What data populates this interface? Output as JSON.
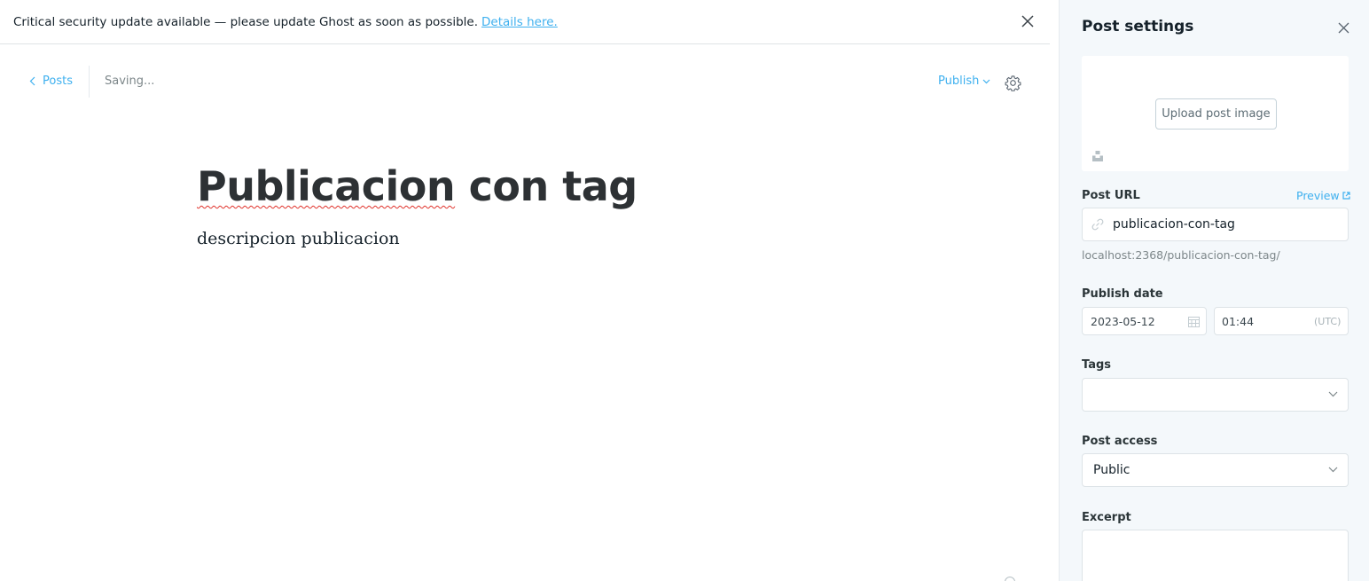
{
  "alert": {
    "message": "Critical security update available — please update Ghost as soon as possible.",
    "link_label": "Details here."
  },
  "editor": {
    "back_label": "Posts",
    "save_status": "Saving...",
    "publish_label": "Publish",
    "title_misspelled": "Publicacion",
    "title_rest": " con tag",
    "body": "descripcion publicacion"
  },
  "settings": {
    "title": "Post settings",
    "upload_label": "Upload post image",
    "post_url_label": "Post URL",
    "preview_label": "Preview",
    "slug": "publicacion-con-tag",
    "full_url": "localhost:2368/publicacion-con-tag/",
    "publish_date_label": "Publish date",
    "date": "2023-05-12",
    "time": "01:44",
    "timezone": "(UTC)",
    "tags_label": "Tags",
    "tags_value": "",
    "access_label": "Post access",
    "access_value": "Public",
    "excerpt_label": "Excerpt",
    "excerpt_value": ""
  },
  "colors": {
    "accent": "#3eb0ef",
    "sidebar_bg": "#f4f8fb",
    "title": "#2d3134",
    "spellcheck": "#e0322b"
  },
  "icons": [
    "close-icon",
    "chevron-left-icon",
    "chevron-down-icon",
    "gear-icon",
    "link-icon",
    "external-link-icon",
    "calendar-icon",
    "unsplash-icon"
  ]
}
